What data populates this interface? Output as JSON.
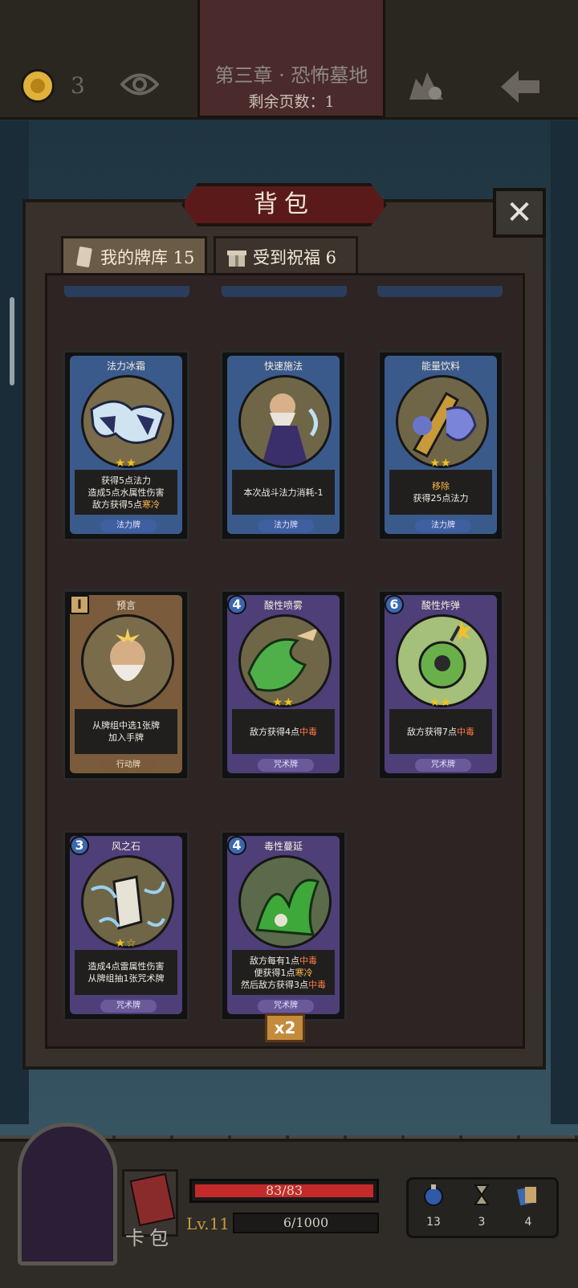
{
  "topbar": {
    "coins": "3",
    "chapter_title": "第三章 · 恐怖墓地",
    "pages_left": "剩余页数：1"
  },
  "panel": {
    "title": "背包",
    "close_label": "✕",
    "tabs": [
      {
        "label": "我的牌库 15"
      },
      {
        "label": "受到祝福 6"
      }
    ]
  },
  "cards": [
    {
      "name": "法力冰霜",
      "lines": [
        "获得5点法力",
        "造成5点水属性伤害",
        "敌方获得5点"
      ],
      "highlight": "寒冷",
      "type": "法力牌",
      "stars": "★★"
    },
    {
      "name": "快速施法",
      "lines": [
        "本次战斗法力消耗-1"
      ],
      "type": "法力牌"
    },
    {
      "name": "能量饮料",
      "lines_hl": "移除",
      "lines": [
        "获得25点法力"
      ],
      "type": "法力牌",
      "stars": "★★"
    },
    {
      "name": "预言",
      "cost": "I",
      "lines": [
        "从牌组中选1张牌",
        "加入手牌"
      ],
      "type": "行动牌"
    },
    {
      "name": "酸性喷雾",
      "cost": "4",
      "lines": [
        "敌方获得4点"
      ],
      "highlight": "中毒",
      "type": "咒术牌",
      "stars": "★★"
    },
    {
      "name": "酸性炸弹",
      "cost": "6",
      "lines": [
        "敌方获得7点"
      ],
      "highlight": "中毒",
      "type": "咒术牌",
      "stars": "★★"
    },
    {
      "name": "风之石",
      "cost": "3",
      "lines": [
        "造成4点雷属性伤害",
        "从牌组抽1张咒术牌"
      ],
      "type": "咒术牌",
      "stars": "★☆"
    },
    {
      "name": "毒性蔓延",
      "cost": "4",
      "lines": [
        "敌方每有1点",
        "便获得1点",
        "然后敌方获得3点"
      ],
      "hl1": "中毒",
      "hl2": "寒冷",
      "hl3": "中毒",
      "type": "咒术牌",
      "copies": "x2"
    }
  ],
  "bottombar": {
    "deck_label": "卡包",
    "hp": "83/83",
    "hp_fraction": 1.0,
    "level": "Lv.11",
    "xp": "6/1000",
    "resources": [
      {
        "icon": "potion-icon",
        "value": "13"
      },
      {
        "icon": "hourglass-icon",
        "value": "3"
      },
      {
        "icon": "cards-icon",
        "value": "4"
      }
    ]
  },
  "colors": {
    "accent_gold": "#f4c21f",
    "keyword_highlight": "#ffb84a",
    "hp_red": "#c42a2a"
  }
}
